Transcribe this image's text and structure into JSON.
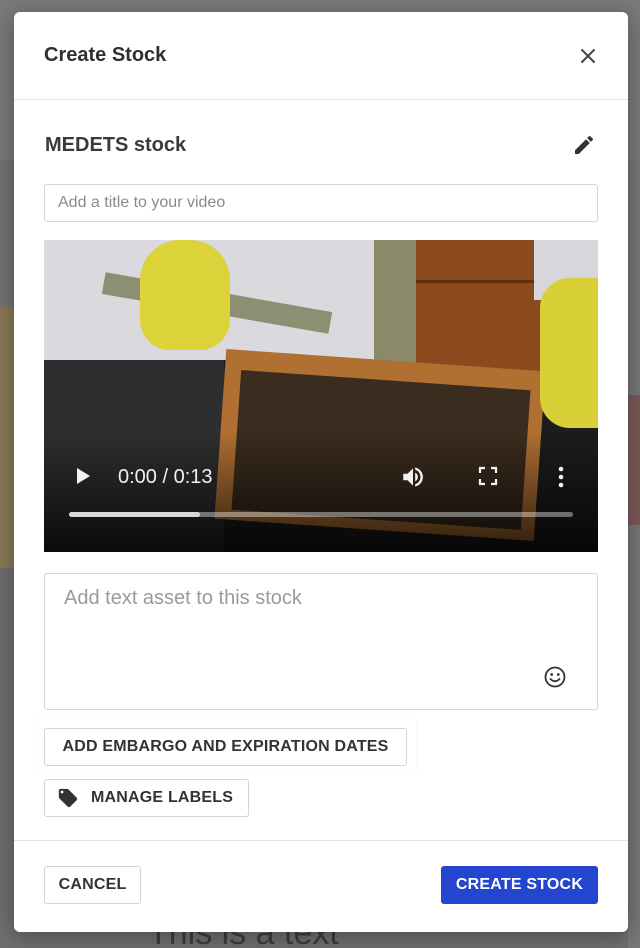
{
  "background": {
    "partial_text": "This is a text"
  },
  "modal": {
    "title": "Create Stock",
    "stock_name": "MEDETS stock",
    "title_input": {
      "placeholder": "Add a title to your video",
      "value": ""
    },
    "video": {
      "time_display": "0:00 / 0:13",
      "progress_fraction": 0.26
    },
    "text_asset": {
      "placeholder": "Add text asset to this stock",
      "value": ""
    },
    "buttons": {
      "embargo": "ADD EMBARGO AND EXPIRATION DATES",
      "labels": "MANAGE LABELS",
      "cancel": "CANCEL",
      "create": "CREATE STOCK"
    },
    "icons": {
      "close": "close-icon",
      "edit": "pencil-icon",
      "play": "play-icon",
      "volume": "volume-icon",
      "fullscreen": "fullscreen-icon",
      "more": "more-vertical-icon",
      "emoji": "emoji-icon",
      "label": "tag-icon"
    }
  },
  "colors": {
    "primary": "#2445d0",
    "overlay": "#6f6f6f"
  }
}
